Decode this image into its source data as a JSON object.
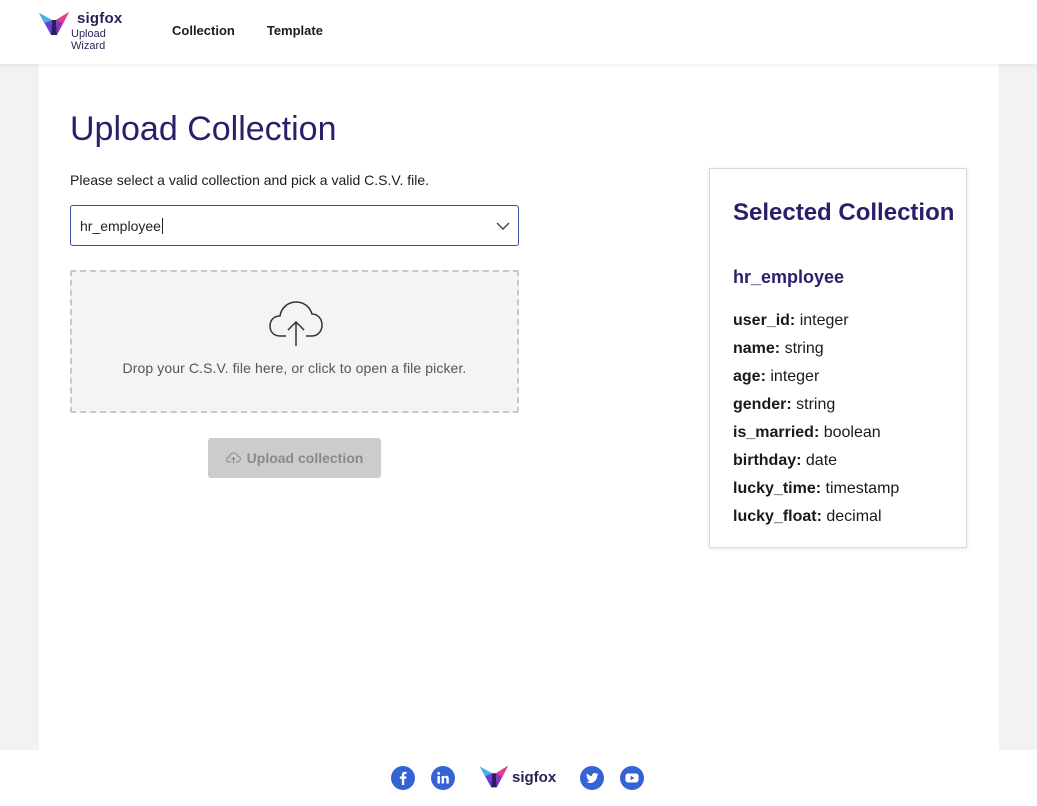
{
  "header": {
    "brand_name": "sigfox",
    "brand_sub": "Upload Wizard",
    "nav": [
      {
        "label": "Collection"
      },
      {
        "label": "Template"
      }
    ]
  },
  "main": {
    "title": "Upload Collection",
    "instructions": "Please select a valid collection and pick a valid C.S.V. file.",
    "collection_select": {
      "value": "hr_employee",
      "icon": "chevron-down-icon"
    },
    "dropzone": {
      "text": "Drop your C.S.V. file here, or click to open a file picker.",
      "icon": "cloud-upload-icon"
    },
    "upload_button": {
      "label": "Upload collection",
      "disabled": true,
      "icon": "cloud-upload-icon"
    }
  },
  "card": {
    "title": "Selected Collection",
    "collection": "hr_employee",
    "fields": [
      {
        "name": "user_id:",
        "type": "integer"
      },
      {
        "name": "name:",
        "type": "string"
      },
      {
        "name": "age:",
        "type": "integer"
      },
      {
        "name": "gender:",
        "type": "string"
      },
      {
        "name": "is_married:",
        "type": "boolean"
      },
      {
        "name": "birthday:",
        "type": "date"
      },
      {
        "name": "lucky_time:",
        "type": "timestamp"
      },
      {
        "name": "lucky_float:",
        "type": "decimal"
      }
    ]
  },
  "footer": {
    "brand_name": "sigfox",
    "social": [
      "facebook-icon",
      "linkedin-icon",
      "twitter-icon",
      "youtube-icon"
    ]
  },
  "colors": {
    "brand_purple": "#2b1e6b",
    "social_blue": "#3563d6",
    "select_border": "#3b4f9e",
    "button_disabled": "#cccccc"
  }
}
